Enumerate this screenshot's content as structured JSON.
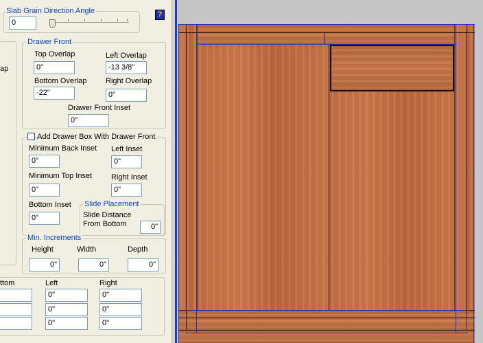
{
  "slab_grain": {
    "legend": "Slab Grain Direction Angle",
    "value": "0"
  },
  "help_icon_text": "?",
  "drawer_front": {
    "legend": "Drawer Front",
    "top_overlap_label": "Top Overlap",
    "top_overlap_value": "0\"",
    "left_overlap_label": "Left Overlap",
    "left_overlap_value": "-13 3/8\"",
    "bottom_overlap_label": "Bottom Overlap",
    "bottom_overlap_value": "-22\"",
    "right_overlap_label": "Right Overlap",
    "right_overlap_value": "0\"",
    "inset_label": "Drawer Front Inset",
    "inset_value": "0\""
  },
  "left_partial_label": "ap",
  "drawer_box": {
    "checkbox_label": "Add Drawer Box With Drawer Front",
    "min_back_inset_label": "Minimum Back Inset",
    "min_back_inset_value": "0\"",
    "left_inset_label": "Left Inset",
    "left_inset_value": "0\"",
    "min_top_inset_label": "Minimum Top Inset",
    "min_top_inset_value": "0\"",
    "right_inset_label": "Right Inset",
    "right_inset_value": "0\"",
    "bottom_inset_label": "Bottom Inset",
    "bottom_inset_value": "0\""
  },
  "slide_placement": {
    "legend": "Slide Placement",
    "distance_label_line1": "Slide Distance",
    "distance_label_line2": "From Bottom",
    "distance_value": "0\""
  },
  "min_increments": {
    "legend": "Min. Increments",
    "height_label": "Height",
    "height_value": "0\"",
    "width_label": "Width",
    "width_value": "0\"",
    "depth_label": "Depth",
    "depth_value": "0\""
  },
  "bottom_table": {
    "col_partial": "ttom",
    "col_left": "Left",
    "col_right": "Right",
    "rows": [
      {
        "partial": "",
        "left": "0\"",
        "right": "0\""
      },
      {
        "partial": "",
        "left": "0\"",
        "right": "0\""
      },
      {
        "partial": "",
        "left": "0\"",
        "right": "0\""
      }
    ]
  },
  "colors": {
    "legend_blue": "#0b46d8",
    "wireframe_blue": "#2233cc",
    "wood": "#c27247"
  }
}
